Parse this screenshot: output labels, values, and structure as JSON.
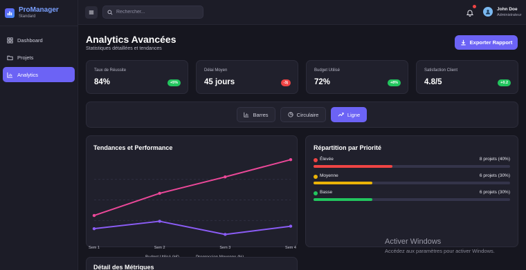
{
  "brand": {
    "name": "ProManager",
    "plan": "Standard",
    "icon": "chart-bar-icon"
  },
  "sidebar": {
    "items": [
      {
        "label": "Dashboard",
        "icon": "dashboard-icon",
        "active": false
      },
      {
        "label": "Projets",
        "icon": "folder-icon",
        "active": false
      },
      {
        "label": "Analytics",
        "icon": "chart-bar-icon",
        "active": true
      }
    ]
  },
  "topbar": {
    "search_placeholder": "Rechercher...",
    "user": {
      "name": "John Doe",
      "role": "Administrateur"
    }
  },
  "header": {
    "title": "Analytics Avancées",
    "subtitle": "Statistiques détaillées et tendances",
    "export_label": "Exporter Rapport"
  },
  "stats": [
    {
      "label": "Taux de Réussite",
      "value": "84%",
      "badge": "+5%",
      "badge_color": "#22c55e"
    },
    {
      "label": "Délai Moyen",
      "value": "45 jours",
      "badge": "-3j",
      "badge_color": "#ef4444"
    },
    {
      "label": "Budget Utilisé",
      "value": "72%",
      "badge": "+8%",
      "badge_color": "#22c55e"
    },
    {
      "label": "Satisfaction Client",
      "value": "4.8/5",
      "badge": "+0.2",
      "badge_color": "#22c55e"
    }
  ],
  "chart_tabs": [
    {
      "label": "Barres",
      "icon": "bar-chart-icon",
      "active": false
    },
    {
      "label": "Circulaire",
      "icon": "pie-chart-icon",
      "active": false
    },
    {
      "label": "Ligne",
      "icon": "trend-icon",
      "active": true
    }
  ],
  "trend_panel": {
    "title": "Tendances et Performance"
  },
  "chart_data": {
    "type": "line",
    "title": "Tendances et Performance",
    "categories": [
      "Sem 1",
      "Sem 2",
      "Sem 3",
      "Sem 4"
    ],
    "series": [
      {
        "name": "Budget Utilisé (k€)",
        "color": "#8b5cf6",
        "values": [
          15,
          24,
          8,
          18
        ]
      },
      {
        "name": "Progression Moyenne (%)",
        "color": "#ec4899",
        "values": [
          31,
          58,
          78,
          99
        ]
      }
    ],
    "ylim": [
      0,
      100
    ],
    "grid": true,
    "legend_position": "bottom"
  },
  "priority_panel": {
    "title": "Répartition par Priorité",
    "items": [
      {
        "label": "Élevée",
        "count": "8 projets (40%)",
        "fraction": 0.4,
        "color": "#ef4444"
      },
      {
        "label": "Moyenne",
        "count": "6 projets (30%)",
        "fraction": 0.3,
        "color": "#eab308"
      },
      {
        "label": "Basse",
        "count": "6 projets (30%)",
        "fraction": 0.3,
        "color": "#22c55e"
      }
    ]
  },
  "details": {
    "title": "Détail des Métriques"
  },
  "watermark": {
    "title": "Activer Windows",
    "subtitle": "Accédez aux paramètres pour activer Windows."
  },
  "colors": {
    "accent": "#6c63f5",
    "background": "#16161f",
    "panel": "#20202c"
  }
}
